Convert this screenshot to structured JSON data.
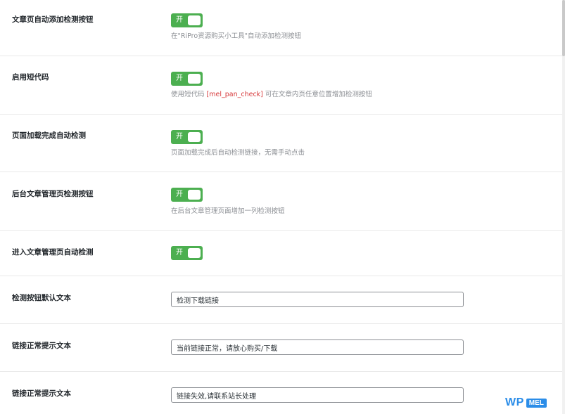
{
  "settings": {
    "toggle_rows": [
      {
        "label": "文章页自动添加检测按钮",
        "toggle_label": "开",
        "desc_pre": "在\"RiPro资源购买小工具\"自动添加检测按钮",
        "desc_code": "",
        "desc_post": ""
      },
      {
        "label": "启用短代码",
        "toggle_label": "开",
        "desc_pre": "使用短代码 ",
        "desc_code": "[mel_pan_check]",
        "desc_post": " 可在文章内页任意位置增加检测按钮"
      },
      {
        "label": "页面加载完成自动检测",
        "toggle_label": "开",
        "desc_pre": "页面加载完成后自动检测链接，无需手动点击",
        "desc_code": "",
        "desc_post": ""
      },
      {
        "label": "后台文章管理页检测按钮",
        "toggle_label": "开",
        "desc_pre": "在后台文章管理页面增加一列检测按钮",
        "desc_code": "",
        "desc_post": ""
      },
      {
        "label": "进入文章管理页自动检测",
        "toggle_label": "开",
        "desc_pre": "",
        "desc_code": "",
        "desc_post": ""
      }
    ],
    "text_rows": [
      {
        "label": "检测按钮默认文本",
        "value": "检测下载链接"
      },
      {
        "label": "链接正常提示文本",
        "value": "当前链接正常，请放心购买/下载"
      },
      {
        "label": "链接正常提示文本",
        "value": "链接失效,请联系站长处理"
      }
    ]
  },
  "watermark": {
    "wp": "WP",
    "mel": "MEL"
  },
  "colors": {
    "toggle_on": "#4caf50",
    "code_highlight": "#d63638",
    "brand_blue": "#2b8de8"
  }
}
